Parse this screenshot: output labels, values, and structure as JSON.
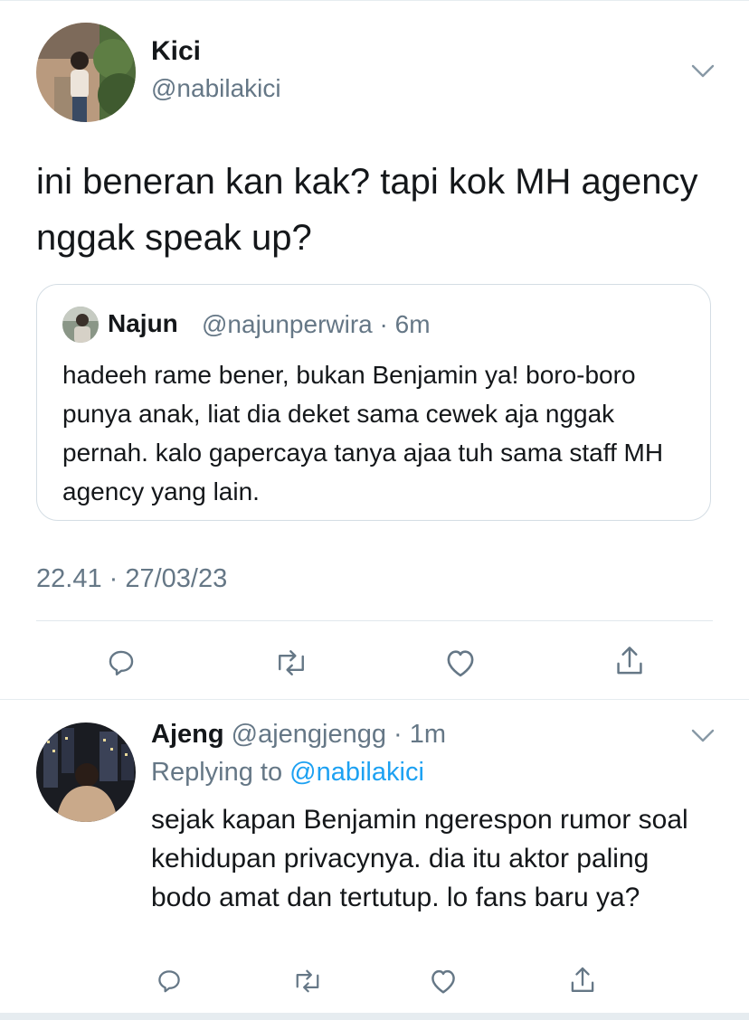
{
  "main_tweet": {
    "display_name": "Kici",
    "handle": "@nabilakici",
    "text": "ini beneran kan kak? tapi kok MH agency nggak speak up?",
    "timestamp": "22.41 · 27/03/23",
    "avatar_icon": "user-photo-avatar",
    "menu_icon": "chevron-down-icon"
  },
  "quoted_tweet": {
    "display_name": "Najun",
    "meta": "@najunperwira · 6m",
    "text": "hadeeh rame bener, bukan Benjamin ya! boro-boro punya anak, liat dia deket sama cewek aja nggak pernah. kalo gapercaya tanya ajaa tuh sama staff MH agency yang lain."
  },
  "reply_tweet": {
    "display_name": "Ajeng",
    "meta": "@ajengjengg · 1m",
    "replying_prefix": "Replying to",
    "replying_mention": "@nabilakici",
    "text": "sejak kapan Benjamin ngerespon rumor soal kehidupan privacynya. dia itu aktor paling bodo amat dan tertutup. lo fans baru ya?"
  },
  "actions": [
    "reply-icon",
    "retweet-icon",
    "like-icon",
    "share-icon"
  ],
  "colors": {
    "text": "#14171a",
    "secondary": "#657786",
    "link": "#1da1f2",
    "border": "#e1e8ed"
  }
}
